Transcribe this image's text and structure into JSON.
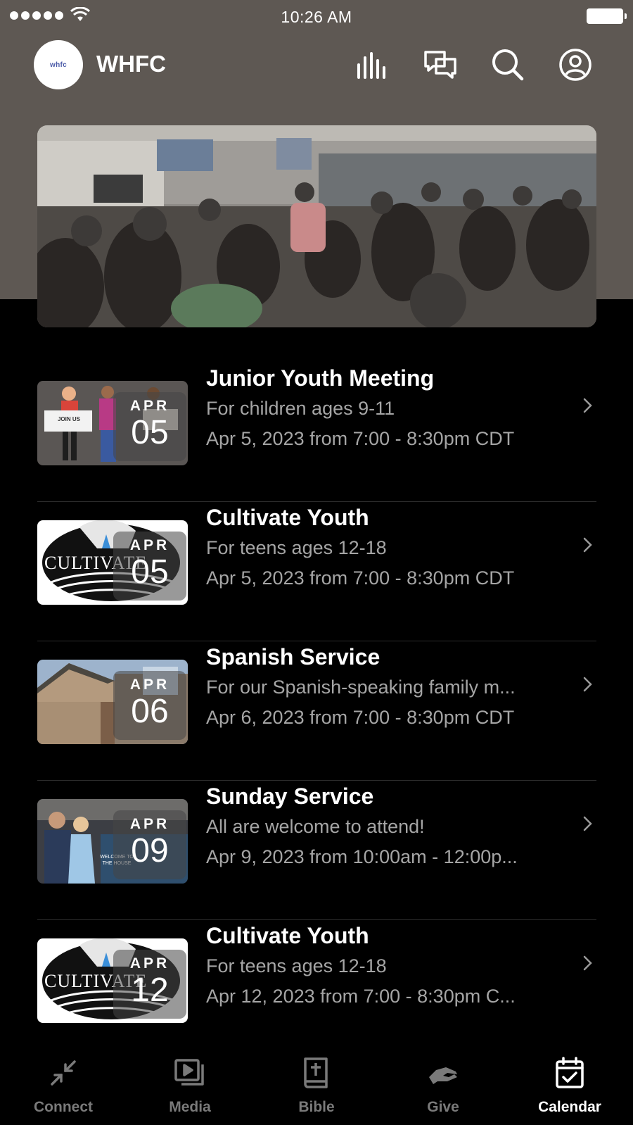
{
  "status_bar": {
    "time": "10:26 AM"
  },
  "app_bar": {
    "logo_text": "whfc",
    "title": "WHFC",
    "icons": [
      "audio-bars-icon",
      "chat-icon",
      "search-icon",
      "profile-icon"
    ]
  },
  "events": [
    {
      "title": "Junior Youth Meeting",
      "subtitle": "For children ages 9-11",
      "time": "Apr 5, 2023 from 7:00 - 8:30pm CDT",
      "month": "APR",
      "day": "05",
      "thumb_text": "JOIN US"
    },
    {
      "title": "Cultivate Youth",
      "subtitle": "For teens ages 12-18",
      "time": "Apr 5, 2023 from 7:00 - 8:30pm CDT",
      "month": "APR",
      "day": "05",
      "thumb_text": "CULTIVATE"
    },
    {
      "title": "Spanish Service",
      "subtitle": "For our Spanish-speaking family m...",
      "time": "Apr 6, 2023 from 7:00 - 8:30pm CDT",
      "month": "APR",
      "day": "06"
    },
    {
      "title": "Sunday Service",
      "subtitle": "All are welcome to attend!",
      "time": "Apr 9, 2023 from 10:00am - 12:00p...",
      "month": "APR",
      "day": "09",
      "thumb_text": "WELCOME TO THE HOUSE"
    },
    {
      "title": "Cultivate Youth",
      "subtitle": "For teens ages 12-18",
      "time": "Apr 12, 2023 from 7:00 - 8:30pm C...",
      "month": "APR",
      "day": "12",
      "thumb_text": "CULTIVATE"
    }
  ],
  "tab_bar": {
    "tabs": [
      {
        "label": "Connect",
        "icon": "connect-icon"
      },
      {
        "label": "Media",
        "icon": "media-icon"
      },
      {
        "label": "Bible",
        "icon": "bible-icon"
      },
      {
        "label": "Give",
        "icon": "give-icon"
      },
      {
        "label": "Calendar",
        "icon": "calendar-icon"
      }
    ],
    "active": "Calendar"
  },
  "colors": {
    "header_bg": "#5e5853",
    "background": "#000000",
    "muted_text": "#a5a5a5",
    "inactive_tab": "#7a7a7a"
  }
}
